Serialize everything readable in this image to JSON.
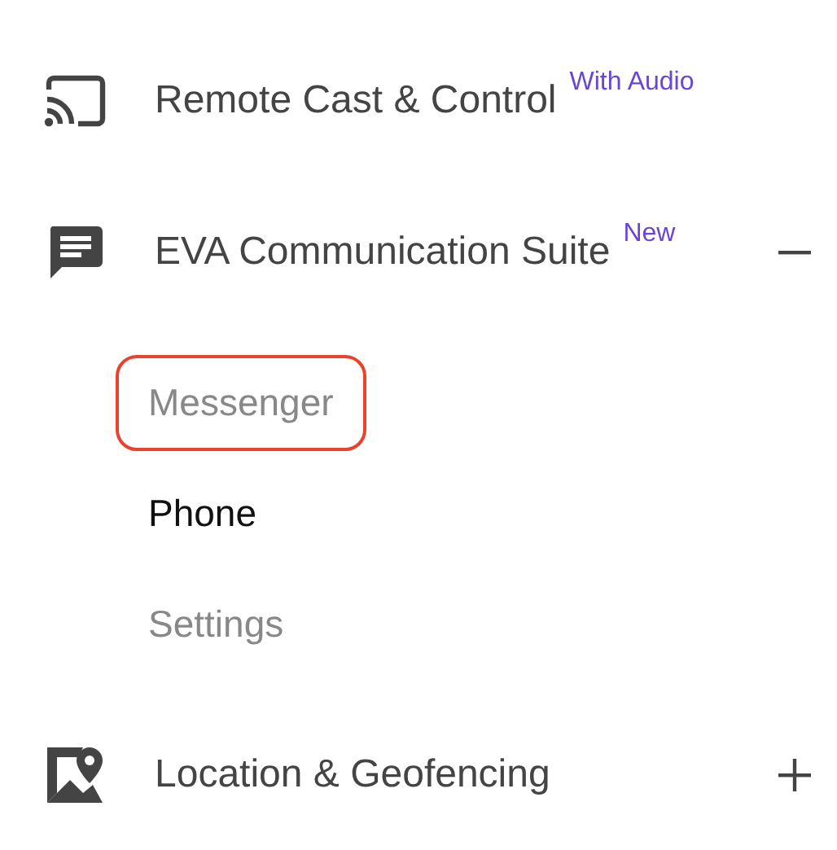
{
  "menu": [
    {
      "kind": "link",
      "title": "Remote Cast & Control",
      "badge": "With Audio"
    },
    {
      "kind": "group",
      "title": "EVA Communication Suite",
      "badge": "New",
      "expanded": true,
      "children": [
        {
          "label": "Messenger",
          "selected": false,
          "highlighted": true
        },
        {
          "label": "Phone",
          "selected": true,
          "highlighted": false
        },
        {
          "label": "Settings",
          "selected": false,
          "highlighted": false
        }
      ]
    },
    {
      "kind": "group",
      "title": "Location & Geofencing",
      "expanded": false
    }
  ]
}
